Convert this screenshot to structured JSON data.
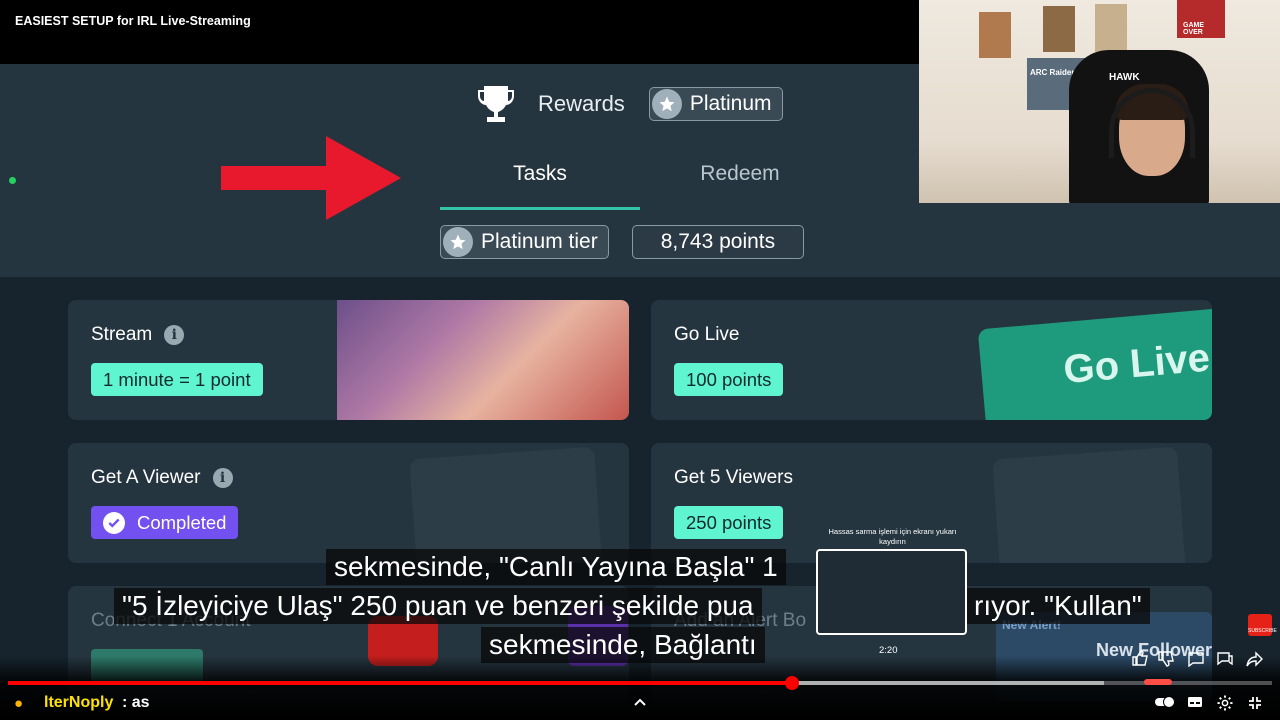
{
  "video": {
    "title": "EASIEST SETUP for IRL Live-Streaming"
  },
  "header": {
    "rewards_label": "Rewards",
    "tier_badge": "Platinum",
    "tabs": [
      {
        "label": "Tasks",
        "active": true
      },
      {
        "label": "Redeem",
        "active": false
      }
    ],
    "tier_label": "Platinum tier",
    "points": "8,743 points"
  },
  "tasks": [
    {
      "title": "Stream",
      "reward": "1 minute = 1 point",
      "has_info": true
    },
    {
      "title": "Go Live",
      "reward": "100 points",
      "art_text": "Go Live"
    },
    {
      "title": "Get A Viewer",
      "reward": "Completed",
      "has_info": true,
      "status": "completed"
    },
    {
      "title": "Get 5 Viewers",
      "reward": "250 points"
    }
  ],
  "partial_cards": {
    "connect": "Connect 1 Account",
    "alert": "Add an Alert Bo",
    "new_alert": "New Alert!",
    "new_follower": "New Follower"
  },
  "webcam": {
    "hawk_label": "HAWK",
    "poster_tag": "ARC Raiders",
    "game_over": "GAME OVER"
  },
  "captions": {
    "line1": "sekmesinde, \"Canlı Yayına Başla\" 1",
    "line2": "\"5 İzleyiciye Ulaş\" 250 puan ve benzeri şekilde pua",
    "line2b": "rıyor.  \"Kullan\"",
    "line3": "sekmesinde, Bağlantı"
  },
  "preview": {
    "hint": "Hassas sarma işlemi için ekranı yukarı kaydırın",
    "time": "2:20"
  },
  "player": {
    "progress": 0.62,
    "loaded": 0.867,
    "channel": "lterNoply",
    "channel_msg": ": as",
    "subscribe": "SUBSCRIBE"
  },
  "colors": {
    "accent": "#32c3a8",
    "pill": "#5ff5d0",
    "completed": "#7350f0",
    "progress": "#ff0000"
  }
}
